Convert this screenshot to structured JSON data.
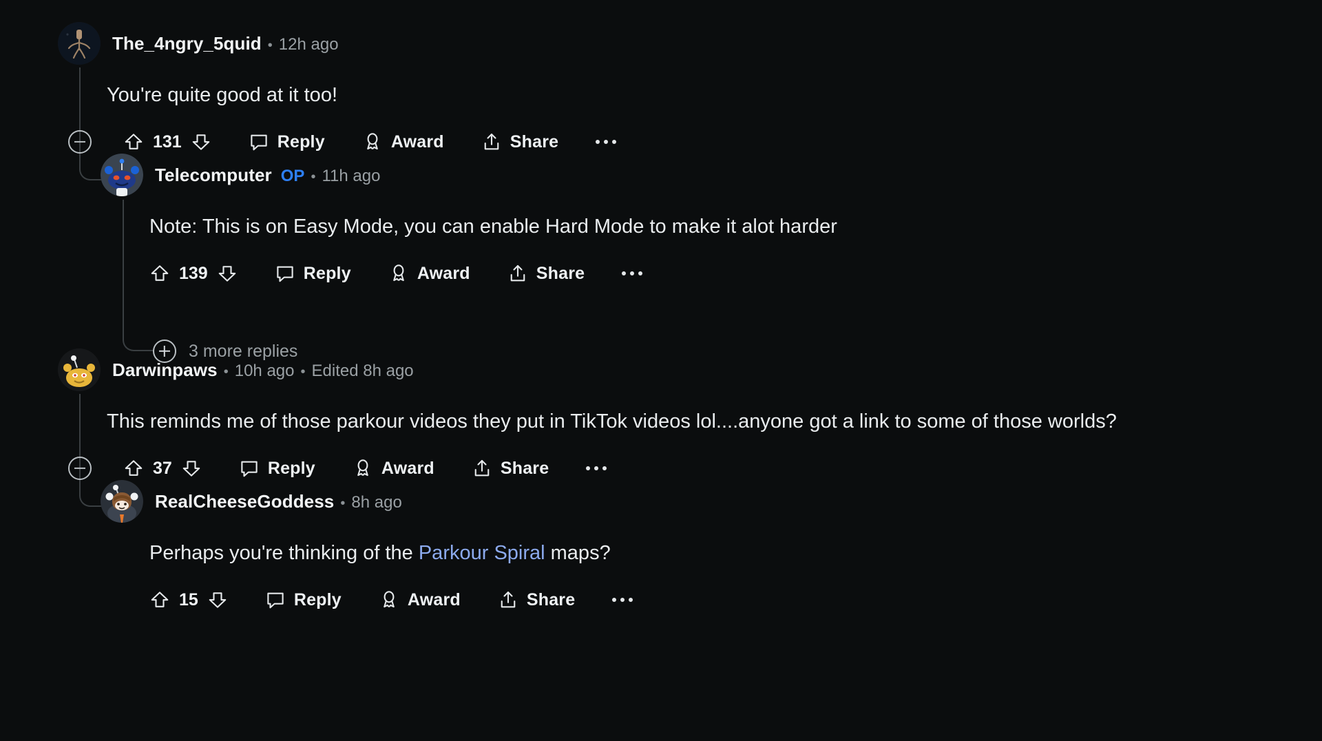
{
  "theme": {
    "background": "#0b0d0e",
    "text": "#e9ecee",
    "muted": "#9aa0a4",
    "op_blue": "#2d7ff5",
    "link_blue": "#8caaee",
    "thread_line": "#3a3f42"
  },
  "labels": {
    "reply": "Reply",
    "award": "Award",
    "share": "Share"
  },
  "comments": [
    {
      "id": "c1",
      "username": "The_4ngry_5quid",
      "op": false,
      "separator": "•",
      "timestamp": "12h ago",
      "body": "You're quite good at it too!",
      "votes": "131",
      "reply": "Reply",
      "award": "Award",
      "share": "Share",
      "avatar_kind": "squid"
    },
    {
      "id": "c2",
      "username": "Telecomputer",
      "op": true,
      "op_label": "OP",
      "separator": "•",
      "timestamp": "11h ago",
      "body": "Note: This is on Easy Mode, you can enable Hard Mode to make it alot harder",
      "votes": "139",
      "reply": "Reply",
      "award": "Award",
      "share": "Share",
      "avatar_kind": "snoo-blue"
    },
    {
      "id": "c3",
      "username": "Darwinpaws",
      "op": false,
      "separator": "•",
      "timestamp": "10h ago",
      "separator2": "•",
      "edited": "Edited 8h ago",
      "body": "This reminds me of those parkour videos they put in TikTok videos lol....anyone got a link to some of those worlds?",
      "votes": "37",
      "reply": "Reply",
      "award": "Award",
      "share": "Share",
      "avatar_kind": "snoo-gold"
    },
    {
      "id": "c4",
      "username": "RealCheeseGoddess",
      "op": false,
      "separator": "•",
      "timestamp": "8h ago",
      "body_before": "Perhaps you're thinking of the ",
      "body_link": "Parkour Spiral",
      "body_after": " maps?",
      "votes": "15",
      "reply": "Reply",
      "award": "Award",
      "share": "Share",
      "avatar_kind": "snoo-brown"
    }
  ],
  "more_replies": {
    "label": "3 more replies"
  }
}
